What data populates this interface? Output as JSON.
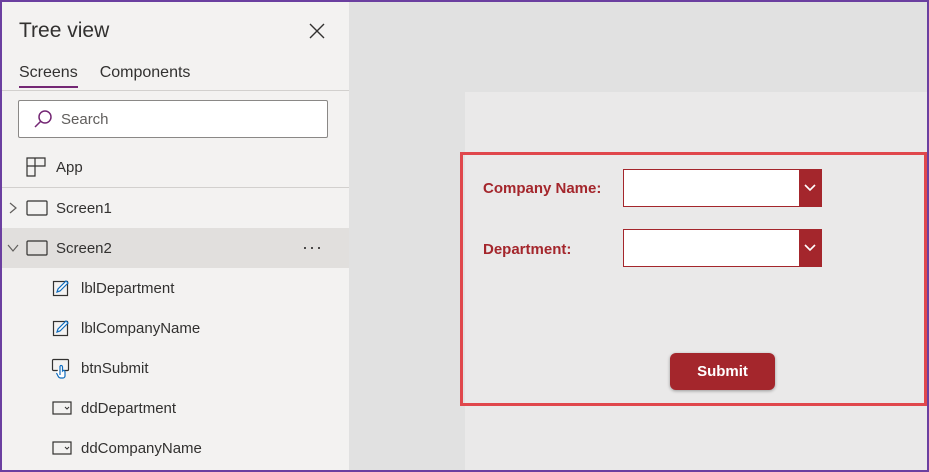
{
  "tree_view": {
    "title": "Tree view",
    "tabs": [
      {
        "label": "Screens",
        "active": true
      },
      {
        "label": "Components",
        "active": false
      }
    ],
    "search_placeholder": "Search",
    "app_label": "App",
    "screens": [
      {
        "label": "Screen1",
        "expanded": false
      },
      {
        "label": "Screen2",
        "expanded": true,
        "selected": true,
        "more": "···"
      }
    ],
    "controls": [
      {
        "label": "lblDepartment",
        "icon": "label-edit-icon"
      },
      {
        "label": "lblCompanyName",
        "icon": "label-edit-icon"
      },
      {
        "label": "btnSubmit",
        "icon": "button-pointer-icon"
      },
      {
        "label": "ddDepartment",
        "icon": "dropdown-control-icon"
      },
      {
        "label": "ddCompanyName",
        "icon": "dropdown-control-icon"
      }
    ]
  },
  "form": {
    "company_label": "Company Name:",
    "department_label": "Department:",
    "company_value": "",
    "department_value": "",
    "submit_label": "Submit"
  },
  "colors": {
    "accent": "#a4262c",
    "highlight": "#e0474c",
    "tab_underline": "#742774",
    "frame": "#6b3fa0"
  }
}
